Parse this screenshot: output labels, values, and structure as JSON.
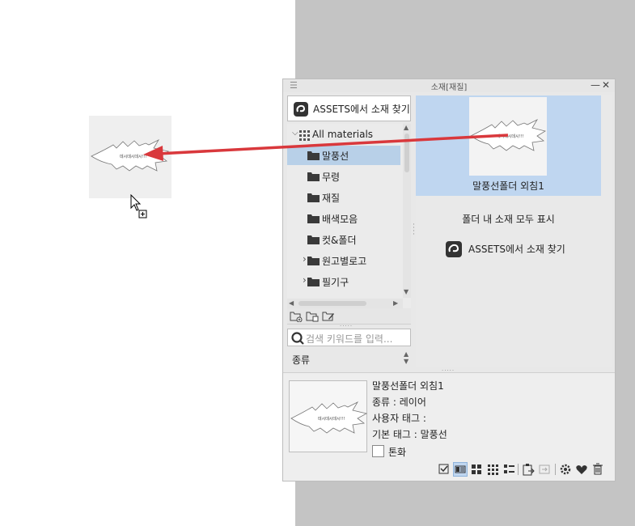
{
  "palette": {
    "title": "소재[재질]",
    "menu_glyph": "☰",
    "minimize": "—",
    "close": "✕"
  },
  "assets_button": {
    "label": "ASSETS에서 소재 찾기"
  },
  "tree": {
    "items": [
      {
        "label": "All materials",
        "icon": "grid-icon",
        "expander": "⌵"
      },
      {
        "label": "말풍선",
        "icon": "folder-icon",
        "selected": true
      },
      {
        "label": "무령",
        "icon": "folder-icon"
      },
      {
        "label": "재질",
        "icon": "folder-icon"
      },
      {
        "label": "배색모음",
        "icon": "folder-icon"
      },
      {
        "label": "컷&폴더",
        "icon": "folder-icon"
      },
      {
        "label": "원고별로고",
        "icon": "folder-icon",
        "expander": "›"
      },
      {
        "label": "필기구",
        "icon": "folder-icon",
        "expander": "›"
      }
    ]
  },
  "tree_toolbar": [
    "new-folder-icon",
    "delete-folder-icon",
    "rename-folder-icon"
  ],
  "search": {
    "placeholder": "검색 키워드를 입력..."
  },
  "kind_label": "종류",
  "material": {
    "name": "말풍선폴더 외침1",
    "thumb_text": "데시데시데시!!!"
  },
  "show_all_label": "폴더 내 소재 모두 표시",
  "assets_link": {
    "label": "ASSETS에서 소재 찾기"
  },
  "detail": {
    "name": "말풍선폴더 외침1",
    "kind": "종류 : 레이어",
    "user_tag": "사용자 태그 :",
    "base_tag": "기본 태그 : 말풍선",
    "toon_label": "톤화",
    "toon_checked": false
  },
  "bottom_toolbar": [
    "checkbox-view-icon",
    "detail-view-icon",
    "large-thumb-view-icon",
    "small-thumb-view-icon",
    "list-view-icon",
    "paste-icon",
    "replace-icon",
    "settings-icon",
    "favorite-icon",
    "delete-icon"
  ],
  "colors": {
    "selection": "#bfd6f0",
    "tree_selection": "#b8d0e8",
    "arrow": "#d9383c",
    "panel_bg": "#e8e8e8",
    "outside_bg": "#c4c4c4"
  }
}
